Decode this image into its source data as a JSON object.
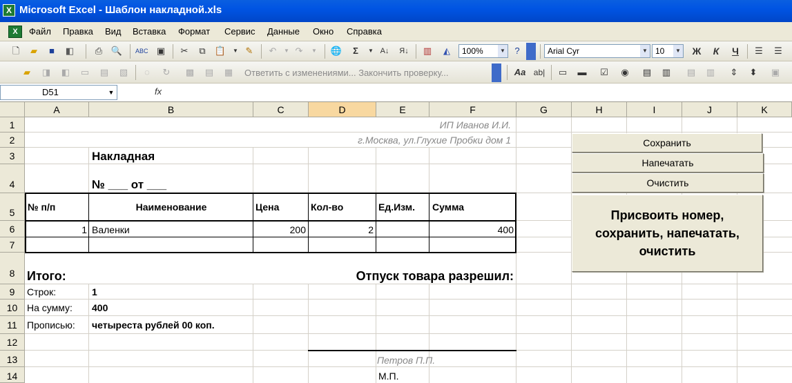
{
  "window": {
    "title": "Microsoft Excel - Шаблон накладной.xls",
    "app_icon": "X"
  },
  "menu": [
    "Файл",
    "Правка",
    "Вид",
    "Вставка",
    "Формат",
    "Сервис",
    "Данные",
    "Окно",
    "Справка"
  ],
  "toolbar": {
    "zoom": "100%",
    "font_name": "Arial Cyr",
    "font_size": "10",
    "bold": "Ж",
    "italic": "К",
    "underline": "Ч",
    "sigma": "Σ",
    "review_text": "Ответить с изменениями... Закончить проверку...",
    "format_aa": "Aa",
    "format_ab": "ab|"
  },
  "formula_bar": {
    "name_box": "D51",
    "fx": "fx"
  },
  "columns": [
    "A",
    "B",
    "C",
    "D",
    "E",
    "F",
    "G",
    "H",
    "I",
    "J",
    "K"
  ],
  "rows": [
    "1",
    "2",
    "3",
    "4",
    "5",
    "6",
    "7",
    "8",
    "9",
    "10",
    "11",
    "12",
    "13",
    "14"
  ],
  "sheet": {
    "company": "ИП Иванов И.И.",
    "address": "г.Москва, ул.Глухие Пробки дом 1",
    "doc_title": "Накладная",
    "number_line": "№ ___ от ___",
    "headers": [
      "№ п/п",
      "Наименование",
      "Цена",
      "Кол-во",
      "Ед.Изм.",
      "Сумма"
    ],
    "item": {
      "num": "1",
      "name": "Валенки",
      "price": "200",
      "qty": "2",
      "unit": "",
      "sum": "400"
    },
    "total_label": "Итого:",
    "release_label": "Отпуск товара разрешил:",
    "rows_label": "Строк:",
    "rows_value": "1",
    "sum_label": "На сумму:",
    "sum_value": "400",
    "words_label": "Прописью:",
    "words_value": "четыреста рублей 00 коп.",
    "signer": "Петров П.П.",
    "stamp": "М.П."
  },
  "buttons": {
    "save": "Сохранить",
    "print": "Напечатать",
    "clear": "Очистить",
    "all_line1": "Присвоить номер,",
    "all_line2": "сохранить, напечатать,",
    "all_line3": "очистить"
  }
}
